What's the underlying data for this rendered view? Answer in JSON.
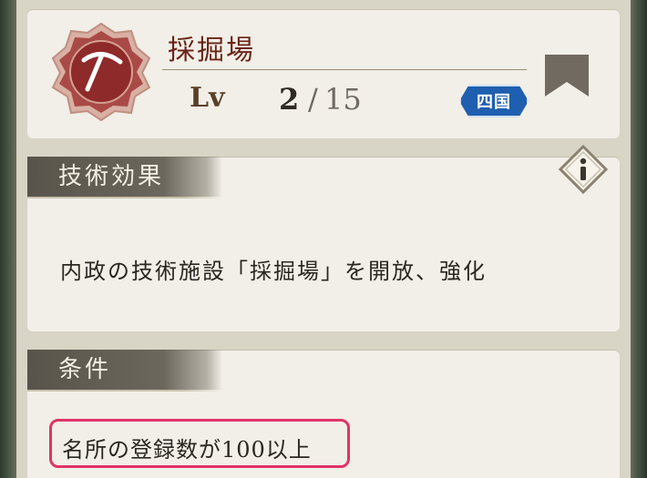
{
  "header": {
    "title": "採掘場",
    "level_label": "Lv",
    "level_current": "2",
    "level_separator": "/",
    "level_max": "15",
    "region_badge": "四国",
    "badge_icon": "pickaxe-icon",
    "bookmark_icon": "bookmark-icon"
  },
  "effect": {
    "heading": "技術効果",
    "description": "内政の技術施設「採掘場」を開放、強化",
    "info_icon": "info-icon"
  },
  "condition": {
    "heading": "条件",
    "requirement": "名所の登録数が100以上"
  },
  "colors": {
    "title": "#6b2418",
    "badge_red": "#8e2a2a",
    "region_blue": "#1f5fb0",
    "highlight": "#e0336a"
  }
}
